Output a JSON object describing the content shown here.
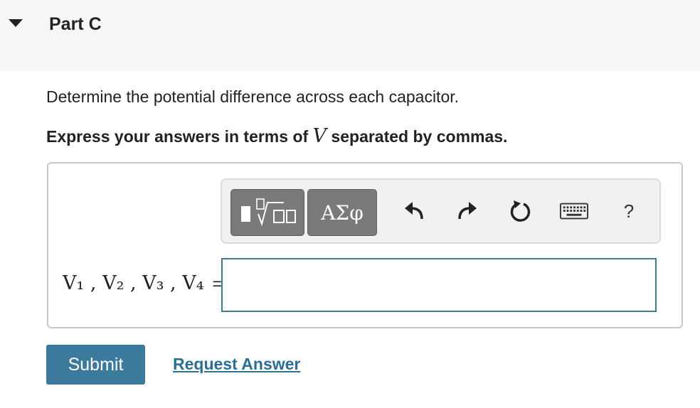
{
  "header": {
    "part_title": "Part C"
  },
  "question": {
    "text": "Determine the potential difference across each capacitor.",
    "instruction_before": "Express your answers in terms of ",
    "instruction_var": "V",
    "instruction_after": " separated by commas."
  },
  "toolbar": {
    "symbols_label": "ΑΣφ",
    "help_label": "?",
    "icons": [
      "templates-icon",
      "undo-icon",
      "redo-icon",
      "reset-icon",
      "keyboard-icon",
      "help-icon"
    ]
  },
  "answer": {
    "label_vars": "V₁ , V₂ , V₃ , V₄",
    "label_eq": "=",
    "value": "",
    "placeholder": ""
  },
  "actions": {
    "submit_label": "Submit",
    "request_label": "Request Answer"
  },
  "colors": {
    "submit_bg": "#3b7a9c",
    "link": "#2a6f95",
    "input_border": "#3e7a8c",
    "toolbar_button": "#7a7a7a"
  }
}
